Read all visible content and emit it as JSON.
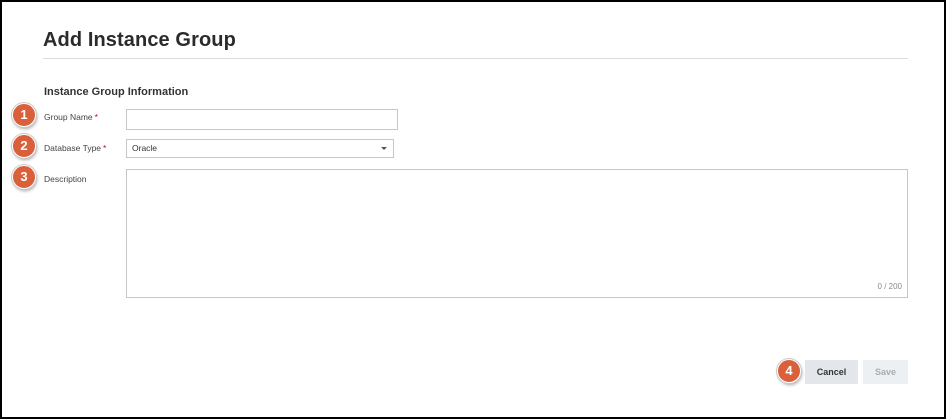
{
  "page": {
    "title": "Add Instance Group"
  },
  "section": {
    "heading": "Instance Group Information"
  },
  "fields": {
    "group_name": {
      "label": "Group Name",
      "required_mark": "*",
      "value": ""
    },
    "database_type": {
      "label": "Database Type",
      "required_mark": "*",
      "value": "Oracle"
    },
    "description": {
      "label": "Description",
      "value": "",
      "char_count": "0 / 200"
    }
  },
  "markers": [
    "1",
    "2",
    "3",
    "4"
  ],
  "actions": {
    "cancel_label": "Cancel",
    "save_label": "Save"
  },
  "colors": {
    "marker": "#d9603b",
    "required": "#d0021b",
    "cancel_bg": "#e3e6ea",
    "save_bg_disabled": "#edf0f3"
  }
}
